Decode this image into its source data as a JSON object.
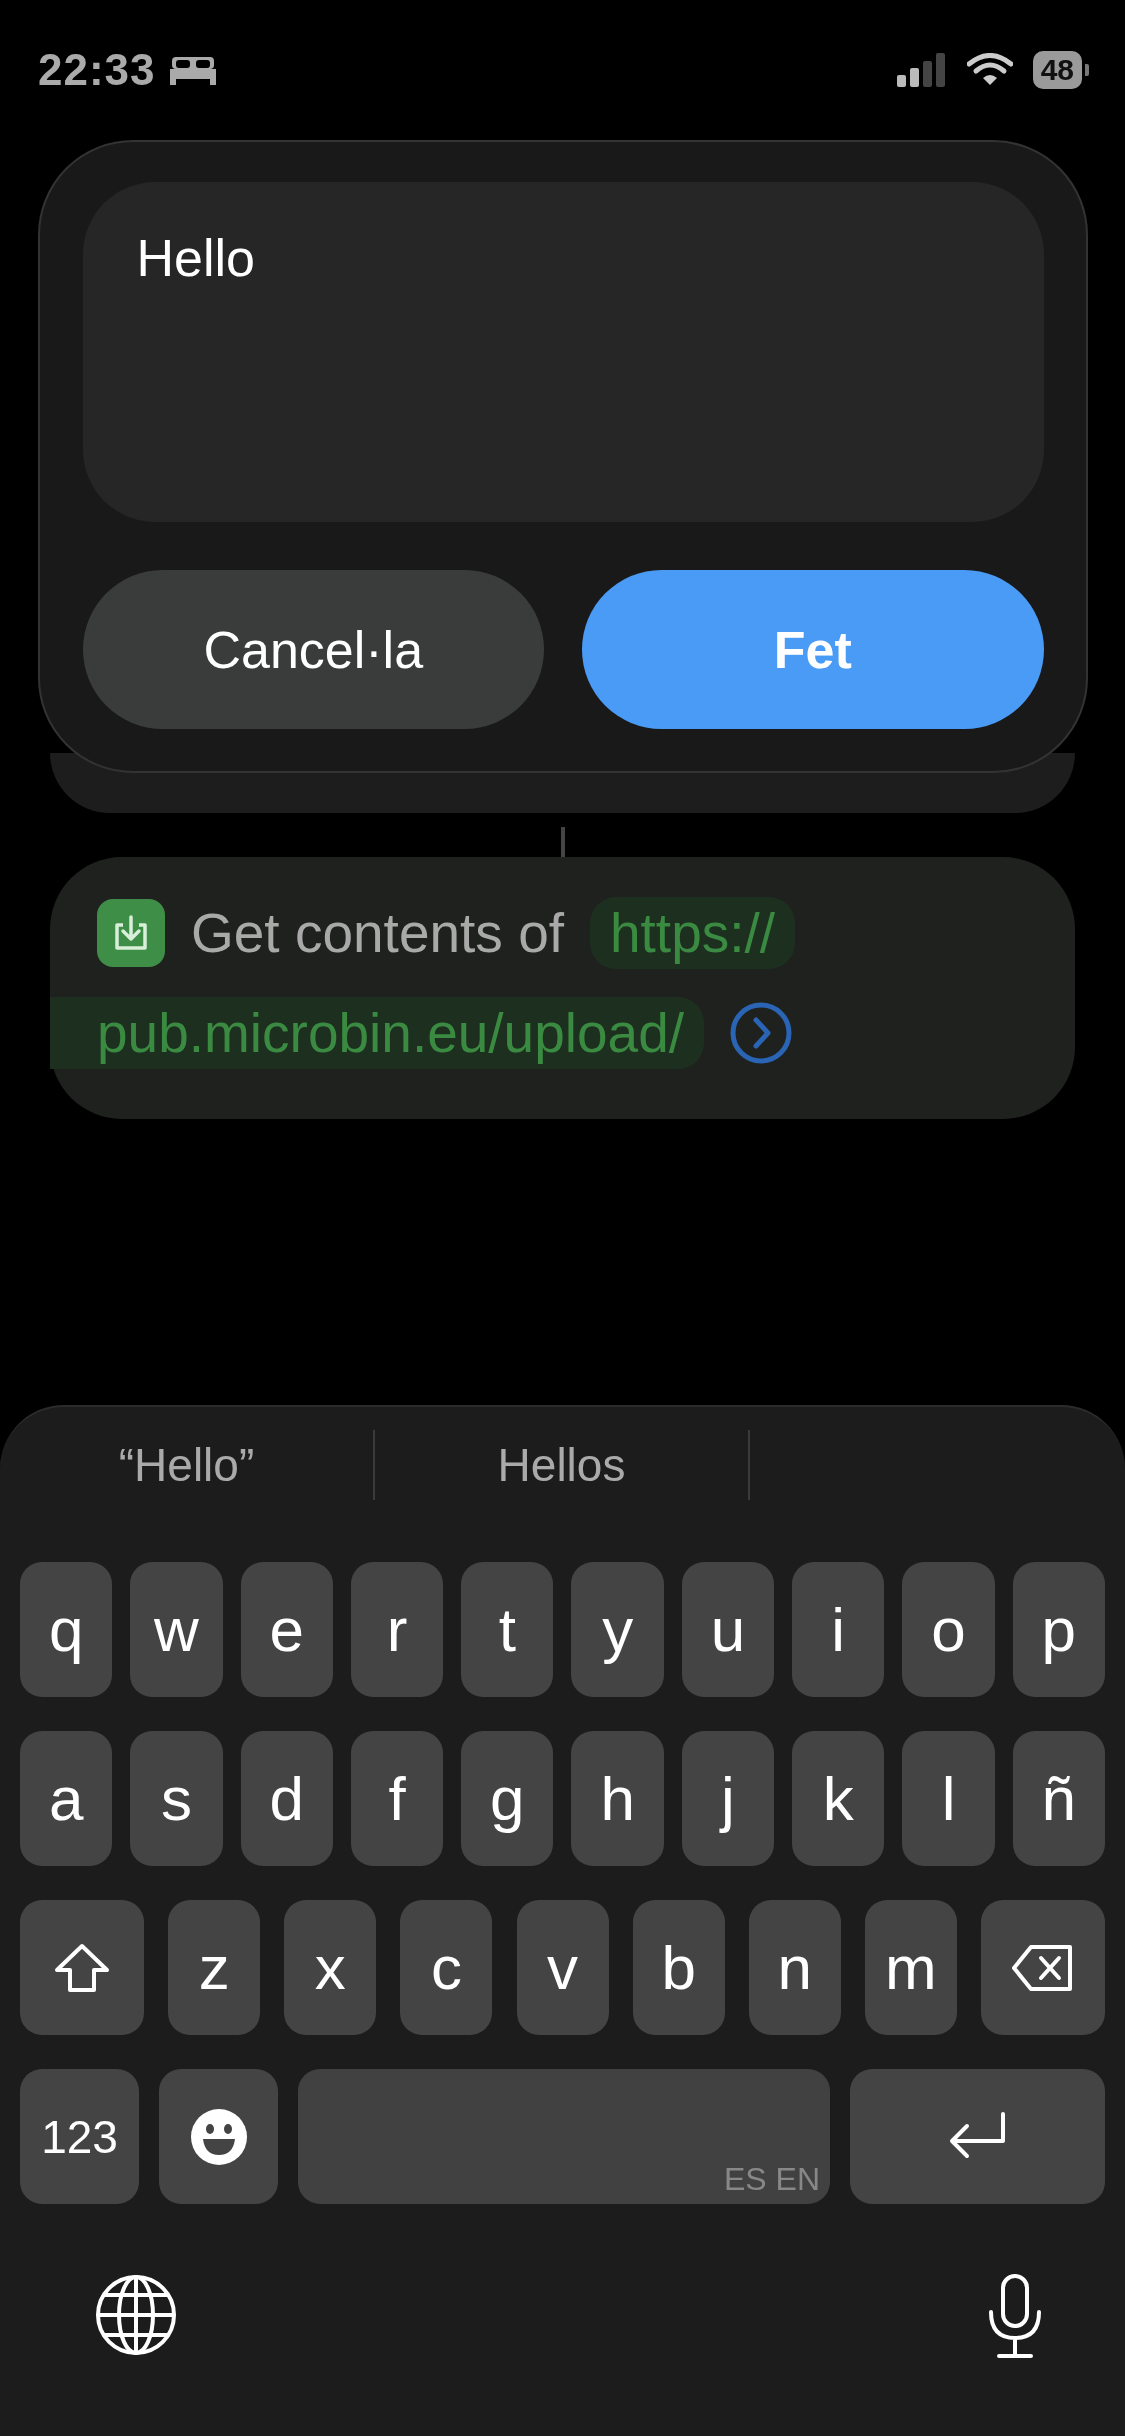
{
  "status_bar": {
    "time": "22:33",
    "battery": "48"
  },
  "dialog": {
    "text": "Hello",
    "buttons": [
      {
        "label": "Cancel·la",
        "kind": "secondary"
      },
      {
        "label": "Fet",
        "kind": "primary"
      }
    ]
  },
  "action": {
    "label": "Get contents of",
    "url_lines": [
      "https://",
      "pub.microbin.eu/upload/"
    ]
  },
  "keyboard": {
    "suggestions": [
      "“Hello”",
      "Hellos"
    ],
    "rows": [
      [
        {
          "kind": "letter",
          "label": "q"
        },
        {
          "kind": "letter",
          "label": "w"
        },
        {
          "kind": "letter",
          "label": "e"
        },
        {
          "kind": "letter",
          "label": "r"
        },
        {
          "kind": "letter",
          "label": "t"
        },
        {
          "kind": "letter",
          "label": "y"
        },
        {
          "kind": "letter",
          "label": "u"
        },
        {
          "kind": "letter",
          "label": "i"
        },
        {
          "kind": "letter",
          "label": "o"
        },
        {
          "kind": "letter",
          "label": "p"
        }
      ],
      [
        {
          "kind": "letter",
          "label": "a"
        },
        {
          "kind": "letter",
          "label": "s"
        },
        {
          "kind": "letter",
          "label": "d"
        },
        {
          "kind": "letter",
          "label": "f"
        },
        {
          "kind": "letter",
          "label": "g"
        },
        {
          "kind": "letter",
          "label": "h"
        },
        {
          "kind": "letter",
          "label": "j"
        },
        {
          "kind": "letter",
          "label": "k"
        },
        {
          "kind": "letter",
          "label": "l"
        },
        {
          "kind": "letter",
          "label": "ñ"
        }
      ],
      [
        {
          "kind": "shift"
        },
        {
          "kind": "letter",
          "label": "z"
        },
        {
          "kind": "letter",
          "label": "x"
        },
        {
          "kind": "letter",
          "label": "c"
        },
        {
          "kind": "letter",
          "label": "v"
        },
        {
          "kind": "letter",
          "label": "b"
        },
        {
          "kind": "letter",
          "label": "n"
        },
        {
          "kind": "letter",
          "label": "m"
        },
        {
          "kind": "delete"
        }
      ],
      [
        {
          "kind": "numbers",
          "label": "123"
        },
        {
          "kind": "emoji"
        },
        {
          "kind": "space",
          "label": "ES EN"
        },
        {
          "kind": "return"
        }
      ]
    ]
  }
}
